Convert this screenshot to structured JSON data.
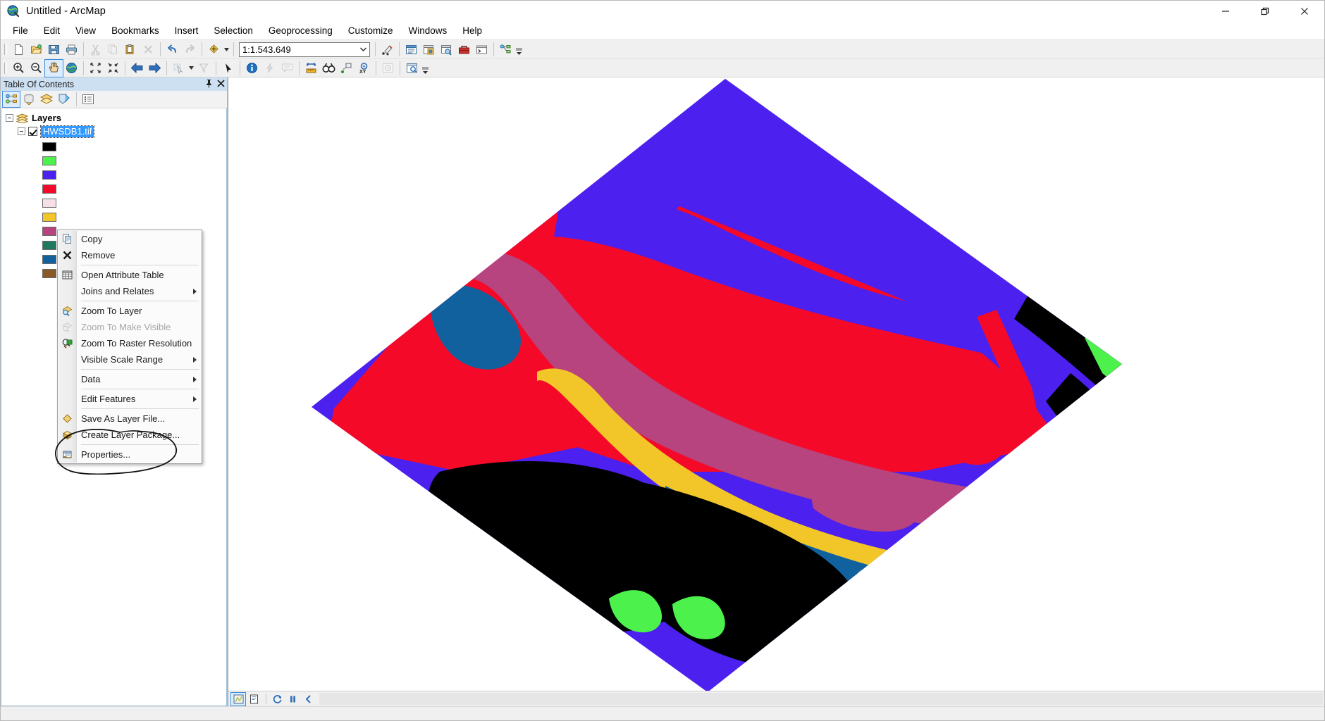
{
  "window": {
    "title": "Untitled - ArcMap",
    "app_icon": "arcmap-globe-icon",
    "minimize_label": "Minimize",
    "restore_label": "Restore",
    "close_label": "Close"
  },
  "menubar": {
    "items": [
      {
        "label": "File",
        "name": "menu-file"
      },
      {
        "label": "Edit",
        "name": "menu-edit"
      },
      {
        "label": "View",
        "name": "menu-view"
      },
      {
        "label": "Bookmarks",
        "name": "menu-bookmarks"
      },
      {
        "label": "Insert",
        "name": "menu-insert"
      },
      {
        "label": "Selection",
        "name": "menu-selection"
      },
      {
        "label": "Geoprocessing",
        "name": "menu-geoprocessing"
      },
      {
        "label": "Customize",
        "name": "menu-customize"
      },
      {
        "label": "Windows",
        "name": "menu-windows"
      },
      {
        "label": "Help",
        "name": "menu-help"
      }
    ]
  },
  "standard_toolbar": {
    "scale_value": "1:1.543.649",
    "scale_placeholder": "1:1.543.649",
    "buttons": [
      "new-document-icon",
      "open-document-icon",
      "save-icon",
      "print-icon",
      "cut-icon",
      "copy-icon",
      "paste-icon",
      "delete-icon",
      "undo-icon",
      "redo-icon",
      "add-data-icon",
      "editor-toolbar-icon",
      "table-of-contents-icon",
      "catalog-icon",
      "search-icon",
      "arctoolbox-icon",
      "python-window-icon",
      "model-builder-icon"
    ]
  },
  "tools_toolbar": {
    "buttons": [
      "zoom-in-icon",
      "zoom-out-icon",
      "pan-icon",
      "full-extent-icon",
      "fixed-zoom-in-icon",
      "fixed-zoom-out-icon",
      "go-back-extent-icon",
      "go-forward-extent-icon",
      "select-features-icon",
      "clear-selection-icon",
      "select-elements-icon",
      "identify-icon",
      "hyperlink-icon",
      "html-popup-icon",
      "measure-icon",
      "find-icon",
      "find-route-icon",
      "go-to-xy-icon",
      "time-slider-icon",
      "create-viewer-window-icon"
    ],
    "active": "pan-icon"
  },
  "table_of_contents": {
    "title": "Table Of Contents",
    "pin_label": "Auto Hide",
    "close_label": "Close",
    "toolbar_buttons": [
      "list-by-drawing-order-icon",
      "list-by-source-icon",
      "list-by-visibility-icon",
      "list-by-selection-icon",
      "options-icon"
    ],
    "active_toolbar_button": "list-by-drawing-order-icon",
    "root": {
      "label": "Layers",
      "icon": "layers-icon",
      "expanded": true
    },
    "layer": {
      "name": "HWSDB1.tif",
      "checked": true,
      "selected": true,
      "expanded": true
    },
    "legend_swatches": [
      {
        "color": "#000000",
        "name": "legend-swatch-black"
      },
      {
        "color": "#4cf14c",
        "name": "legend-swatch-green"
      },
      {
        "color": "#4c20ef",
        "name": "legend-swatch-blue-violet"
      },
      {
        "color": "#f40a28",
        "name": "legend-swatch-red"
      },
      {
        "color": "#f6e0e5",
        "name": "legend-swatch-pale-pink"
      },
      {
        "color": "#f2c629",
        "name": "legend-swatch-gold"
      },
      {
        "color": "#b7437f",
        "name": "legend-swatch-magenta"
      },
      {
        "color": "#1e7a5e",
        "name": "legend-swatch-teal-green"
      },
      {
        "color": "#10619e",
        "name": "legend-swatch-blue"
      },
      {
        "color": "#8a5a26",
        "name": "legend-swatch-brown"
      }
    ]
  },
  "context_menu": {
    "items": [
      {
        "label": "Copy",
        "icon": "copy-icon",
        "submenu": false,
        "disabled": false,
        "sep_after": false
      },
      {
        "label": "Remove",
        "icon": "remove-x-icon",
        "submenu": false,
        "disabled": false,
        "sep_after": true
      },
      {
        "label": "Open Attribute Table",
        "icon": "attribute-table-icon",
        "submenu": false,
        "disabled": false,
        "sep_after": false
      },
      {
        "label": "Joins and Relates",
        "icon": "none",
        "submenu": true,
        "disabled": false,
        "sep_after": true
      },
      {
        "label": "Zoom To Layer",
        "icon": "zoom-to-layer-icon",
        "submenu": false,
        "disabled": false,
        "sep_after": false
      },
      {
        "label": "Zoom To Make Visible",
        "icon": "zoom-make-visible-icon",
        "submenu": false,
        "disabled": true,
        "sep_after": false
      },
      {
        "label": "Zoom To Raster Resolution",
        "icon": "zoom-raster-resolution-icon",
        "submenu": false,
        "disabled": false,
        "sep_after": false
      },
      {
        "label": "Visible Scale Range",
        "icon": "none",
        "submenu": true,
        "disabled": false,
        "sep_after": true
      },
      {
        "label": "Data",
        "icon": "none",
        "submenu": true,
        "disabled": false,
        "sep_after": true
      },
      {
        "label": "Edit Features",
        "icon": "none",
        "submenu": true,
        "disabled": false,
        "sep_after": true
      },
      {
        "label": "Save As Layer File...",
        "icon": "layer-file-icon",
        "submenu": false,
        "disabled": false,
        "sep_after": false
      },
      {
        "label": "Create Layer Package...",
        "icon": "layer-package-icon",
        "submenu": false,
        "disabled": false,
        "sep_after": true
      },
      {
        "label": "Properties...",
        "icon": "properties-icon",
        "submenu": false,
        "disabled": false,
        "sep_after": false
      }
    ],
    "annotation": {
      "target": "Properties...",
      "shape": "hand-drawn-ellipse",
      "color": "#101010"
    }
  },
  "map": {
    "background": "#ffffff",
    "rotation_deg": -25,
    "raster_classes": [
      {
        "color": "#4c20ef",
        "name": "class-blue-violet"
      },
      {
        "color": "#f40a28",
        "name": "class-red"
      },
      {
        "color": "#b7437f",
        "name": "class-magenta"
      },
      {
        "color": "#f2c629",
        "name": "class-gold"
      },
      {
        "color": "#10619e",
        "name": "class-blue"
      },
      {
        "color": "#000000",
        "name": "class-black"
      },
      {
        "color": "#4cf14c",
        "name": "class-green"
      },
      {
        "color": "#f6e0e5",
        "name": "class-pale-pink"
      },
      {
        "color": "#8a5a26",
        "name": "class-brown"
      },
      {
        "color": "#1e7a5e",
        "name": "class-teal-green"
      }
    ]
  },
  "statusbar": {
    "buttons": [
      "data-view-icon",
      "layout-view-icon",
      "refresh-icon",
      "pause-drawing-icon",
      "collapse-icon"
    ],
    "active": "data-view-icon",
    "message": ""
  }
}
